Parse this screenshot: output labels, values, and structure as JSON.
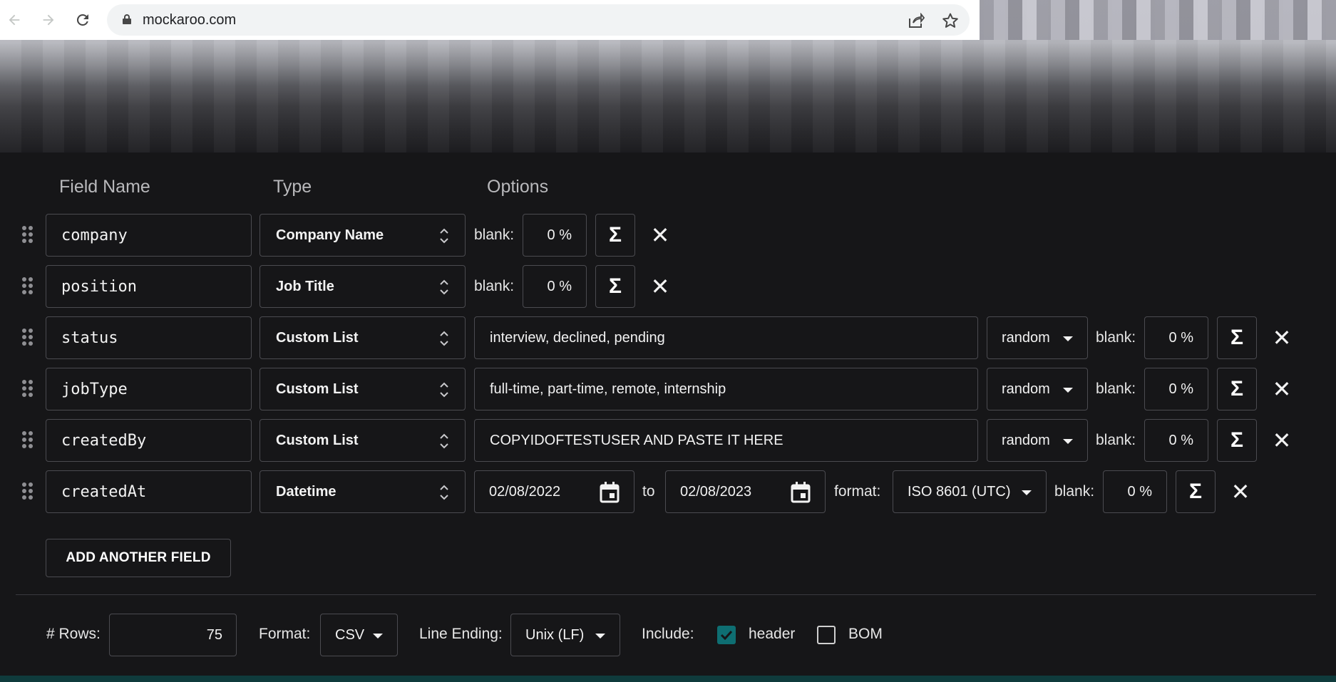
{
  "browser": {
    "url": "mockaroo.com"
  },
  "table_headers": {
    "field_name": "Field Name",
    "type": "Type",
    "options": "Options"
  },
  "rows": [
    {
      "name": "company",
      "type": "Company Name",
      "blank_label": "blank:",
      "blank": "0 %"
    },
    {
      "name": "position",
      "type": "Job Title",
      "blank_label": "blank:",
      "blank": "0 %"
    },
    {
      "name": "status",
      "type": "Custom List",
      "values": "interview, declined, pending",
      "selection": "random",
      "blank_label": "blank:",
      "blank": "0 %"
    },
    {
      "name": "jobType",
      "type": "Custom List",
      "values": "full-time, part-time, remote, internship",
      "selection": "random",
      "blank_label": "blank:",
      "blank": "0 %"
    },
    {
      "name": "createdBy",
      "type": "Custom List",
      "values": "COPYIDOFTESTUSER AND PASTE IT HERE",
      "selection": "random",
      "blank_label": "blank:",
      "blank": "0 %"
    },
    {
      "name": "createdAt",
      "type": "Datetime",
      "from": "02/08/2022",
      "to_label": "to",
      "to": "02/08/2023",
      "format_label": "format:",
      "format": "ISO 8601 (UTC)",
      "blank_label": "blank:",
      "blank": "0 %"
    }
  ],
  "sigma_symbol": "Σ",
  "close_symbol": "✕",
  "add_field_label": "ADD ANOTHER FIELD",
  "footer": {
    "rows_label": "# Rows:",
    "rows_value": "75",
    "format_label": "Format:",
    "format_value": "CSV",
    "line_ending_label": "Line Ending:",
    "line_ending_value": "Unix (LF)",
    "include_label": "Include:",
    "header_label": "header",
    "header_checked": true,
    "bom_label": "BOM",
    "bom_checked": false
  },
  "colors": {
    "accent": "#0e6e72",
    "background": "#161618",
    "border": "#4b4b50"
  }
}
